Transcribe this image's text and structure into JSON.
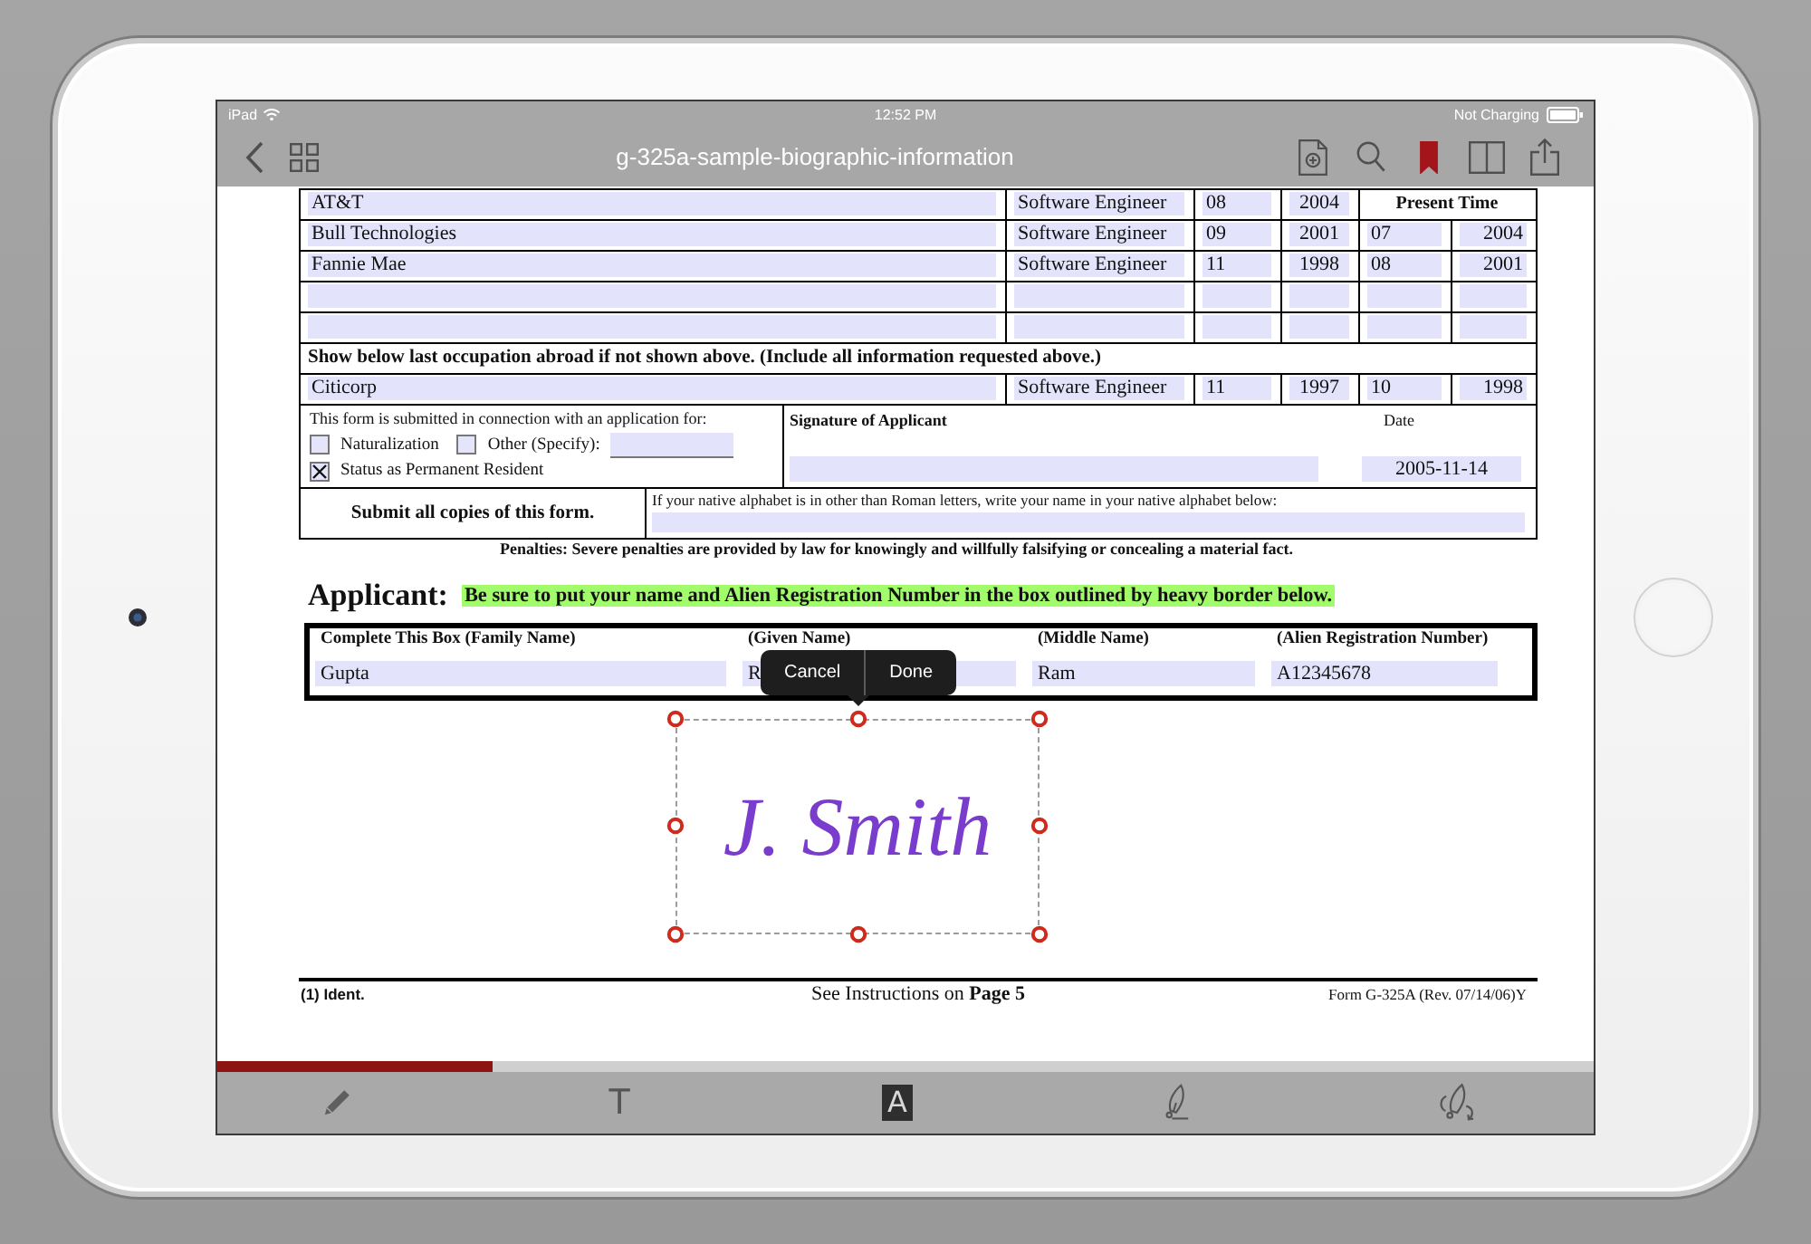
{
  "status_bar": {
    "device": "iPad",
    "time": "12:52 PM",
    "charging": "Not Charging"
  },
  "nav_bar": {
    "title": "g-325a-sample-biographic-information",
    "bookmarked": true
  },
  "form": {
    "employment_rows": [
      {
        "kind": "present",
        "employer": "AT&T",
        "occupation": "Software Engineer",
        "from_month": "08",
        "from_year": "2004",
        "to": "Present Time"
      },
      {
        "kind": "entry",
        "employer": "Bull Technologies",
        "occupation": "Software Engineer",
        "from_month": "09",
        "from_year": "2001",
        "to_month": "07",
        "to_year": "2004"
      },
      {
        "kind": "entry",
        "employer": "Fannie Mae",
        "occupation": "Software Engineer",
        "from_month": "11",
        "from_year": "1998",
        "to_month": "08",
        "to_year": "2001"
      },
      {
        "kind": "blank"
      },
      {
        "kind": "blank"
      },
      {
        "kind": "note",
        "text": "Show below last occupation abroad if not shown above. (Include all information requested above.)"
      },
      {
        "kind": "entry",
        "employer": "Citicorp",
        "occupation": "Software Engineer",
        "from_month": "11",
        "from_year": "1997",
        "to_month": "10",
        "to_year": "1998"
      }
    ],
    "application": {
      "prompt": "This form is submitted in connection with an application for:",
      "options": [
        {
          "kind": "plain",
          "label": "Naturalization",
          "checked": false
        },
        {
          "kind": "specify",
          "label": "Other (Specify):",
          "checked": false
        },
        {
          "kind": "plain",
          "label": "Status as Permanent Resident",
          "checked": true
        }
      ]
    },
    "signature_block": {
      "label": "Signature of Applicant",
      "date_label": "Date",
      "date": "2005-11-14"
    },
    "submit_note": "Submit all copies of this form.",
    "native_alphabet_prompt": "If your native alphabet is in other than Roman letters, write your name in your native alphabet below:",
    "penalties": "Penalties: Severe penalties are provided by law for knowingly and willfully falsifying or concealing a material fact.",
    "applicant": {
      "heading": "Applicant:",
      "notice": "Be sure to put your name and Alien Registration Number in the box outlined by heavy border below.",
      "fields": [
        {
          "label": "Complete This Box (Family Name)",
          "value": "Gupta"
        },
        {
          "label": "(Given Name)",
          "value": "R"
        },
        {
          "label": "(Middle Name)",
          "value": "Ram"
        },
        {
          "label": "(Alien Registration Number)",
          "value": "A12345678"
        }
      ]
    },
    "footer": {
      "left": "(1) Ident.",
      "center": "See Instructions on **Page 5**",
      "right": "Form G-325A (Rev. 07/14/06)Y"
    }
  },
  "signature": {
    "text": "J. Smith"
  },
  "edit_menu": {
    "items": [
      "Cancel",
      "Done"
    ]
  },
  "progress": {
    "level": 0.2
  },
  "toolbar": {
    "tools": [
      {
        "kind": "pencil"
      },
      {
        "kind": "letter",
        "glyph": "T"
      },
      {
        "kind": "boxed-letter",
        "glyph": "A"
      },
      {
        "kind": "pen"
      },
      {
        "kind": "pen-arrow"
      }
    ]
  }
}
